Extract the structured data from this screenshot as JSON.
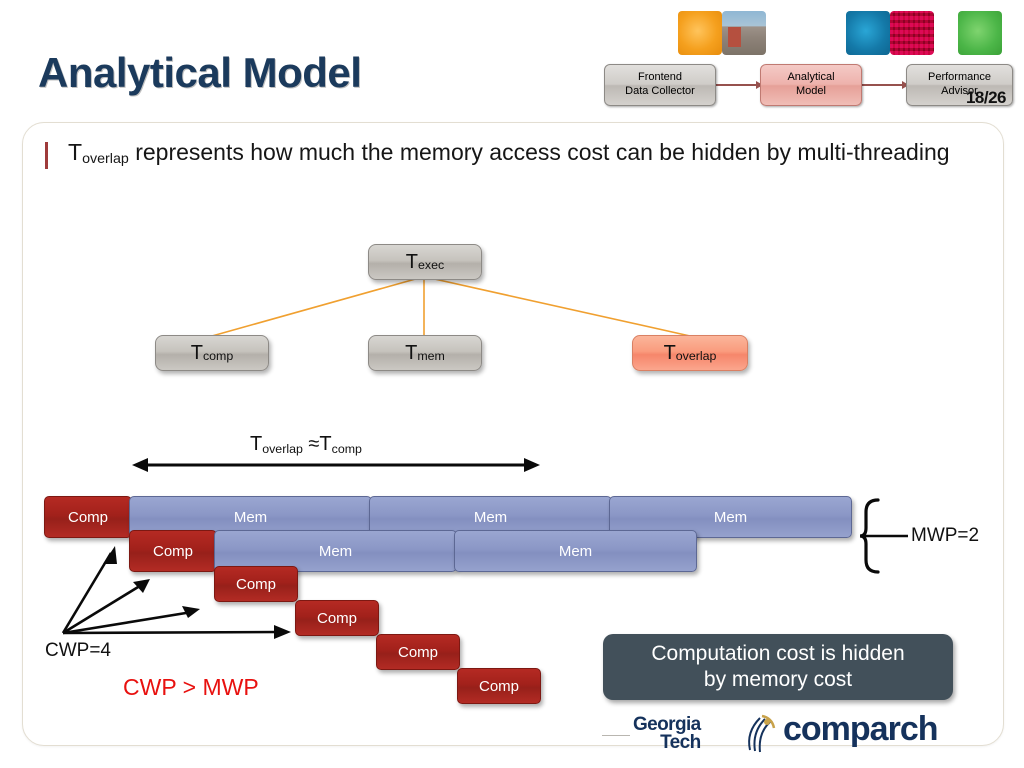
{
  "slide": {
    "title": "Analytical Model",
    "page_number": "18/26"
  },
  "header": {
    "thumbnails": [
      {
        "name": "thumb-orange",
        "color": "#f5a01e"
      },
      {
        "name": "thumb-photo-street",
        "color": "#8d8278"
      },
      {
        "name": "thumb-blue",
        "color": "#1479a8"
      },
      {
        "name": "thumb-photo-chip",
        "color": "#b51f63"
      },
      {
        "name": "thumb-green",
        "color": "#4cb648"
      }
    ],
    "pipeline": [
      {
        "label_line1": "Frontend",
        "label_line2": "Data Collector",
        "active": false
      },
      {
        "label_line1": "Analytical",
        "label_line2": "Model",
        "active": true
      },
      {
        "label_line1": "Performance",
        "label_line2": "Advisor",
        "active": false
      }
    ]
  },
  "body": {
    "bullet": {
      "term": "T",
      "term_sub": "overlap",
      "rest": " represents how much the memory access cost can be hidden by multi-threading"
    }
  },
  "tree": {
    "root": {
      "base": "T",
      "sub": "exec"
    },
    "children": [
      {
        "base": "T",
        "sub": "comp",
        "highlight": false
      },
      {
        "base": "T",
        "sub": "mem",
        "highlight": false
      },
      {
        "base": "T",
        "sub": "overlap",
        "highlight": true
      }
    ]
  },
  "timeline": {
    "overlap_annotation": {
      "t1": "T",
      "t1_sub": "overlap",
      "approx": " ≈",
      "t2": "T",
      "t2_sub": "comp"
    },
    "rows": [
      {
        "blocks": [
          {
            "label": "Comp",
            "type": "comp"
          },
          {
            "label": "Mem",
            "type": "mem"
          },
          {
            "label": "Mem",
            "type": "mem"
          },
          {
            "label": "Mem",
            "type": "mem"
          }
        ]
      },
      {
        "blocks": [
          {
            "label": "Comp",
            "type": "comp"
          },
          {
            "label": "Mem",
            "type": "mem"
          },
          {
            "label": "Mem",
            "type": "mem"
          }
        ]
      },
      {
        "blocks": [
          {
            "label": "Comp",
            "type": "comp"
          }
        ]
      },
      {
        "blocks": [
          {
            "label": "Comp",
            "type": "comp"
          }
        ]
      },
      {
        "blocks": [
          {
            "label": "Comp",
            "type": "comp"
          }
        ]
      },
      {
        "blocks": [
          {
            "label": "Comp",
            "type": "comp"
          }
        ]
      }
    ],
    "cwp_label": "CWP=4",
    "mwp_label": "MWP=2",
    "comparison": "CWP > MWP"
  },
  "callout": {
    "line1": "Computation cost is hidden",
    "line2": "by memory cost"
  },
  "footer": {
    "gt_line1": "Georgia",
    "gt_line2": "Tech",
    "comparch": "comparch"
  },
  "colors": {
    "title": "#1b3a5c",
    "comp": "#a2211b",
    "mem": "#8b97c6",
    "overlap": "#fa9c7e",
    "callout_bg": "#42505a",
    "red_text": "#e8110f",
    "tree_line": "#f0a030"
  }
}
